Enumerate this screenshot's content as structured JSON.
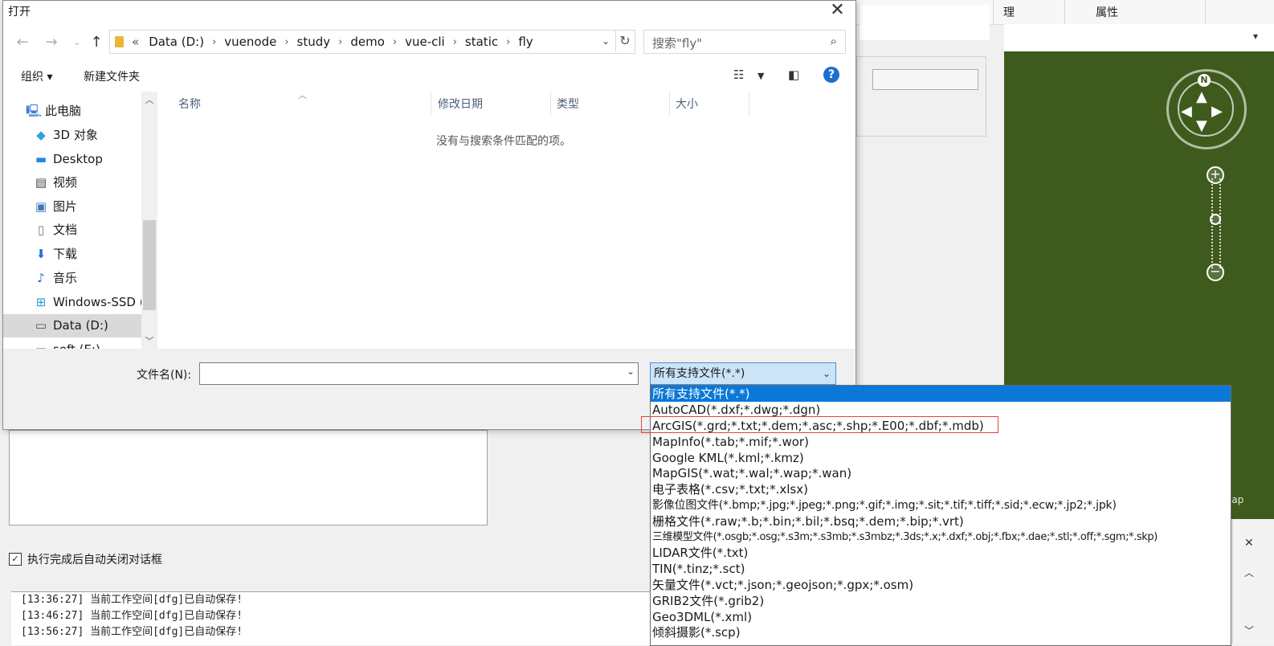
{
  "background_app": {
    "tabs": [
      "理",
      "属性"
    ],
    "map_label": "lap",
    "map_north": "N",
    "auto_close_label": "执行完成后自动关闭对话框",
    "log_lines": [
      "[13:36:27] 当前工作空间[dfg]已自动保存!",
      "[13:46:27] 当前工作空间[dfg]已自动保存!",
      "[13:56:27] 当前工作空间[dfg]已自动保存!"
    ]
  },
  "dialog": {
    "title": "打开",
    "address": {
      "prefix": "«",
      "crumbs": [
        "Data (D:)",
        "vuenode",
        "study",
        "demo",
        "vue-cli",
        "static",
        "fly"
      ]
    },
    "search_placeholder": "搜索\"fly\"",
    "toolbar": {
      "organize": "组织 ▾",
      "new_folder": "新建文件夹"
    },
    "nav_items": [
      {
        "label": "此电脑",
        "icon": "computer-icon"
      },
      {
        "label": "3D 对象",
        "icon": "cube-icon"
      },
      {
        "label": "Desktop",
        "icon": "desktop-icon"
      },
      {
        "label": "视频",
        "icon": "video-icon"
      },
      {
        "label": "图片",
        "icon": "picture-icon"
      },
      {
        "label": "文档",
        "icon": "document-icon"
      },
      {
        "label": "下载",
        "icon": "download-icon"
      },
      {
        "label": "音乐",
        "icon": "music-icon"
      },
      {
        "label": "Windows-SSD (",
        "icon": "drive-icon"
      },
      {
        "label": "Data (D:)",
        "icon": "drive-icon",
        "selected": true
      },
      {
        "label": "soft (E:)",
        "icon": "drive-icon"
      }
    ],
    "columns": [
      "名称",
      "修改日期",
      "类型",
      "大小"
    ],
    "empty_message": "没有与搜索条件匹配的项。",
    "filename_label": "文件名(N):",
    "filename_value": "",
    "filter_selected": "所有支持文件(*.*)",
    "filter_options": [
      "所有支持文件(*.*)",
      "AutoCAD(*.dxf;*.dwg;*.dgn)",
      "ArcGIS(*.grd;*.txt;*.dem;*.asc;*.shp;*.E00;*.dbf;*.mdb)",
      "MapInfo(*.tab;*.mif;*.wor)",
      "Google KML(*.kml;*.kmz)",
      "MapGIS(*.wat;*.wal;*.wap;*.wan)",
      "电子表格(*.csv;*.txt;*.xlsx)",
      "影像位图文件(*.bmp;*.jpg;*.jpeg;*.png;*.gif;*.img;*.sit;*.tif;*.tiff;*.sid;*.ecw;*.jp2;*.jpk)",
      "栅格文件(*.raw;*.b;*.bin;*.bil;*.bsq;*.dem;*.bip;*.vrt)",
      "三维模型文件(*.osgb;*.osg;*.s3m;*.s3mb;*.s3mbz;*.3ds;*.x;*.dxf;*.obj;*.fbx;*.dae;*.stl;*.off;*.sgm;*.skp)",
      "LIDAR文件(*.txt)",
      "TIN(*.tinz;*.sct)",
      "矢量文件(*.vct;*.json;*.geojson;*.gpx;*.osm)",
      "GRIB2文件(*.grib2)",
      "Geo3DML(*.xml)",
      "倾斜摄影(*.scp)"
    ],
    "colors": {
      "selection_blue": "#0a78d7",
      "highlight_red": "#e0453c",
      "map_green": "#3f5a1d"
    }
  }
}
